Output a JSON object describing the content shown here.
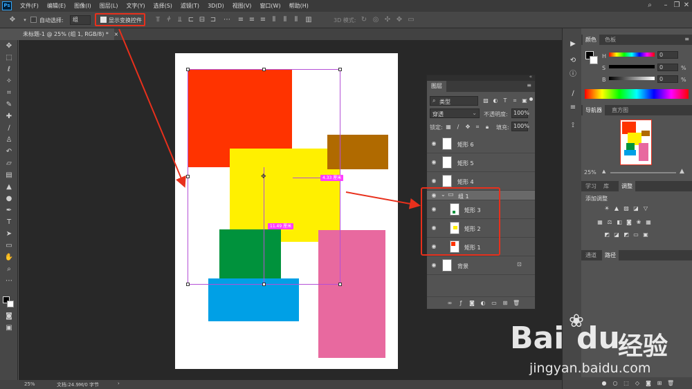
{
  "menubar": {
    "logo": "Ps",
    "items": [
      "文件(F)",
      "编辑(E)",
      "图像(I)",
      "图层(L)",
      "文字(Y)",
      "选择(S)",
      "滤镜(T)",
      "3D(D)",
      "视图(V)",
      "窗口(W)",
      "帮助(H)"
    ]
  },
  "options": {
    "auto_select_label": "自动选择:",
    "auto_select_value": "组",
    "show_transform_label": "显示变换控件",
    "mode_3d_label": "3D 模式:"
  },
  "document": {
    "tab_title": "未标题-1 @ 25% (组 1, RGB/8) *",
    "tab_close": "×",
    "measure_h": "4.33 厘米",
    "measure_v": "11.49 厘米"
  },
  "status": {
    "zoom": "25%",
    "doc_info": "文档:24.9M/0 字节",
    "arrow": "›"
  },
  "layers_panel": {
    "title": "图层",
    "menu_icon": "≡",
    "filter_label": "类型",
    "blend_mode": "穿透",
    "opacity_label": "不透明度:",
    "opacity_value": "100%",
    "lock_label": "锁定:",
    "fill_label": "填充:",
    "fill_value": "100%",
    "layers": [
      {
        "name": "矩形 6"
      },
      {
        "name": "矩形 5"
      },
      {
        "name": "矩形 4"
      },
      {
        "name": "组 1"
      },
      {
        "name": "矩形 3"
      },
      {
        "name": "矩形 2"
      },
      {
        "name": "矩形 1"
      },
      {
        "name": "背景"
      }
    ]
  },
  "right_panels": {
    "color_tab": "颜色",
    "swatch_tab": "色板",
    "h_label": "H",
    "s_label": "S",
    "b_label": "B",
    "h_value": "0",
    "s_value": "0",
    "b_value": "0",
    "unit": "%",
    "nav_tab": "导航器",
    "hist_tab": "直方图",
    "nav_zoom": "25%",
    "learn_tab": "学习",
    "lib_tab": "库",
    "adjust_tab": "调整",
    "add_adjust": "添加调整",
    "channels_tab": "通道",
    "paths_tab": "路径"
  },
  "watermark": {
    "brand": "Bai",
    "brand2": "du",
    "exp": "经验",
    "url": "jingyan.baidu.com"
  },
  "colors": {
    "red": "#ff3300",
    "yellow": "#fff000",
    "brown": "#b06a00",
    "green": "#00923c",
    "blue": "#00a0e6",
    "pink": "#e8699f",
    "annotation": "#e8301c"
  }
}
